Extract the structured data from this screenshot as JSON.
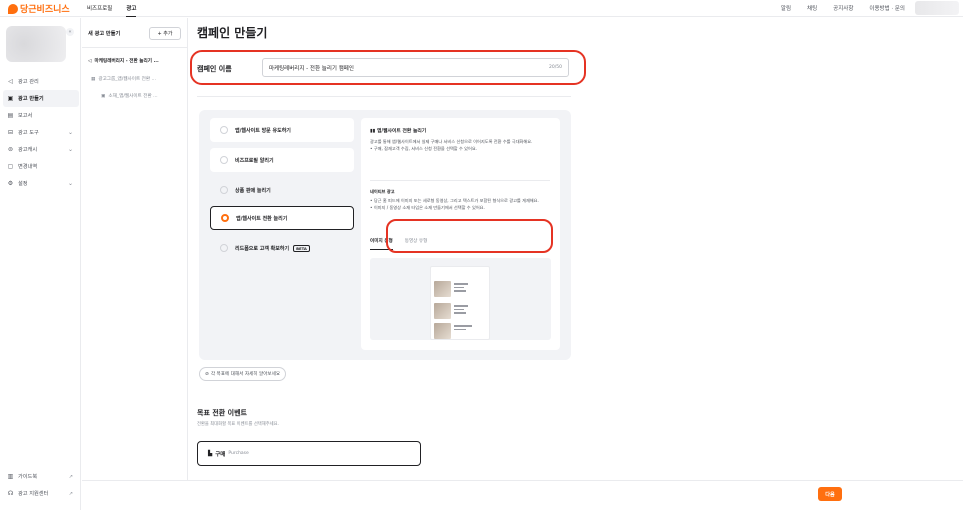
{
  "topbar": {
    "logo": "당근비즈니스",
    "nav": [
      "비즈프로필",
      "광고"
    ],
    "right_links": [
      "알림",
      "채팅",
      "공지사항",
      "이용방법 · 문의"
    ]
  },
  "sidebar": {
    "items": [
      {
        "label": "광고 관리",
        "icon": "megaphone-icon"
      },
      {
        "label": "광고 만들기",
        "icon": "edit-icon"
      },
      {
        "label": "보고서",
        "icon": "report-icon"
      },
      {
        "label": "광고 도구",
        "icon": "briefcase-icon"
      },
      {
        "label": "광고캐시",
        "icon": "coin-icon"
      },
      {
        "label": "변경내역",
        "icon": "history-icon"
      },
      {
        "label": "설정",
        "icon": "gear-icon"
      }
    ],
    "bottom": [
      {
        "label": "가이드북",
        "icon": "book-icon"
      },
      {
        "label": "광고 지원센터",
        "icon": "headset-icon"
      }
    ]
  },
  "tree": {
    "heading": "새 광고 만들기",
    "add_label": "+ 추가",
    "campaign": "마케팅레버리지 - 전환 늘리기 ...",
    "group": "광고그룹_앱/웹사이트 전환 ...",
    "ad": "소재_앱/웹사이트 전환 ..."
  },
  "main": {
    "title": "캠페인 만들기",
    "name_label": "캠페인 이름",
    "name_value": "마케팅레버리지 - 전환 늘리기 캠페인",
    "name_counter": "20/50",
    "goals": [
      {
        "label": "앱/웹사이트 방문 유도하기",
        "selected": false
      },
      {
        "label": "비즈프로필 알리기",
        "selected": false
      },
      {
        "label": "상품 판매 늘리기",
        "selected": false
      },
      {
        "label": "앱/웹사이트 전환 늘리기",
        "selected": true
      },
      {
        "label": "리드폼으로 고객 확보하기",
        "selected": false,
        "badge": "BETA"
      }
    ],
    "desc": {
      "title": "앱/웹사이트 전환 늘리기",
      "text1": "광고를 통해 앱/웹사이트에서 실제 구매나 서비스 신청으로 이어지도록 전환 수를 극대화해요.",
      "bullet1": "구매, 잠재고객 수집, 서비스 신청 전환을 선택할 수 있어요.",
      "native_title": "네이티브 광고",
      "bullet2": "당근 홈 피드에 이미지 또는 세로형 동영상, 그리고 텍스트가 포함된 형식으로 광고를 게재해요.",
      "bullet3": "이미지 / 동영상 소재 타입은 소재 만들기에서 선택할 수 있어요.",
      "tabs": [
        "이미지 유형",
        "동영상 유형"
      ]
    },
    "learn_more": "각 목표에 대해서 자세히 알아보세요",
    "event_title": "목표 전환 이벤트",
    "event_sub": "전환을 최대화할 목표 이벤트를 선택해주세요.",
    "event_label": "구매",
    "event_en": "Purchase",
    "next": "다음"
  },
  "colors": {
    "accent": "#ff6f0f",
    "highlight": "#e53323"
  }
}
